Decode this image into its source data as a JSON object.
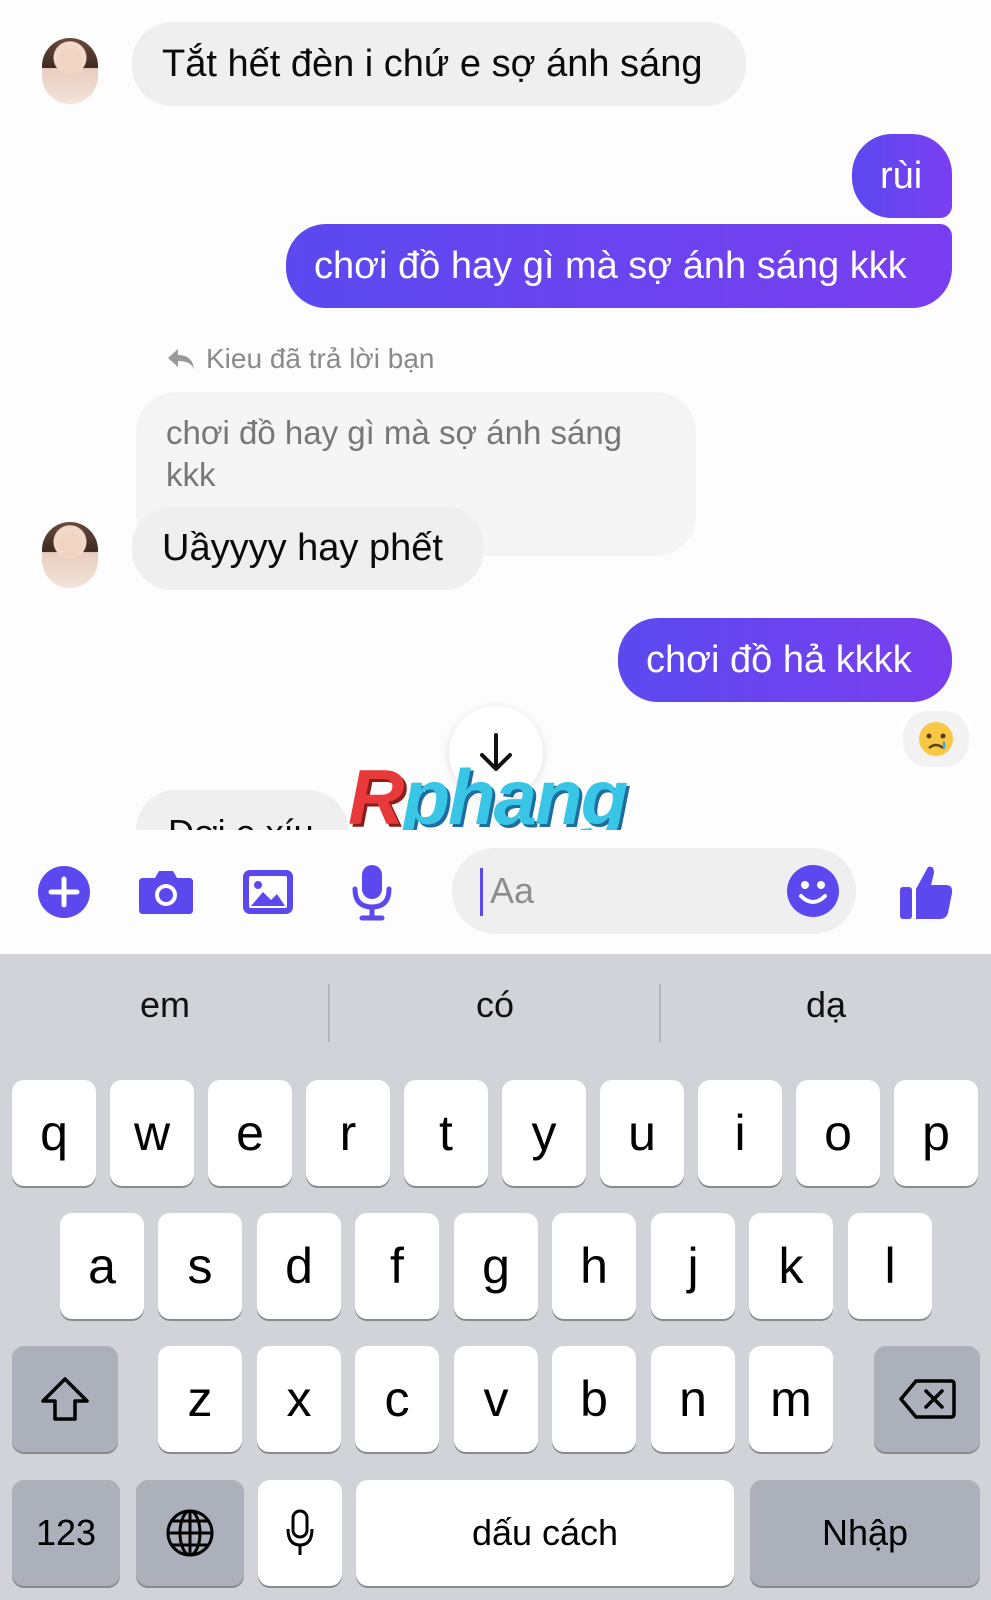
{
  "messages": {
    "m1": "Tắt hết đèn i chứ e sợ ánh sáng",
    "m2": "rùi",
    "m3": "chơi đồ hay gì mà sợ ánh sáng kkk",
    "reply_note": "Kieu đã trả lời bạn",
    "quoted": "chơi đồ hay gì mà sợ ánh sáng kkk",
    "m4": "Uầyyyy hay phết",
    "m5": "chơi đồ hả kkkk",
    "m6_partial": "Đợi e xíu"
  },
  "watermark": "Rphang",
  "composer": {
    "placeholder": "Aa"
  },
  "suggestions": [
    "em",
    "có",
    "dạ"
  ],
  "keys": {
    "row1": [
      "q",
      "w",
      "e",
      "r",
      "t",
      "y",
      "u",
      "i",
      "o",
      "p"
    ],
    "row2": [
      "a",
      "s",
      "d",
      "f",
      "g",
      "h",
      "j",
      "k",
      "l"
    ],
    "row3": [
      "z",
      "x",
      "c",
      "v",
      "b",
      "n",
      "m"
    ],
    "numbers": "123",
    "space": "dấu cách",
    "enter": "Nhập"
  },
  "colors": {
    "accent": "#5b49ef",
    "bubble_in": "#efefef",
    "keyboard_bg": "#d1d3d9"
  },
  "icons": [
    "plus-icon",
    "camera-icon",
    "image-icon",
    "microphone-icon",
    "smiley-icon",
    "thumbs-up-icon",
    "reply-arrow-icon",
    "arrow-down-icon",
    "crying-face-icon",
    "shift-icon",
    "backspace-icon",
    "globe-icon",
    "dictation-mic-icon"
  ]
}
